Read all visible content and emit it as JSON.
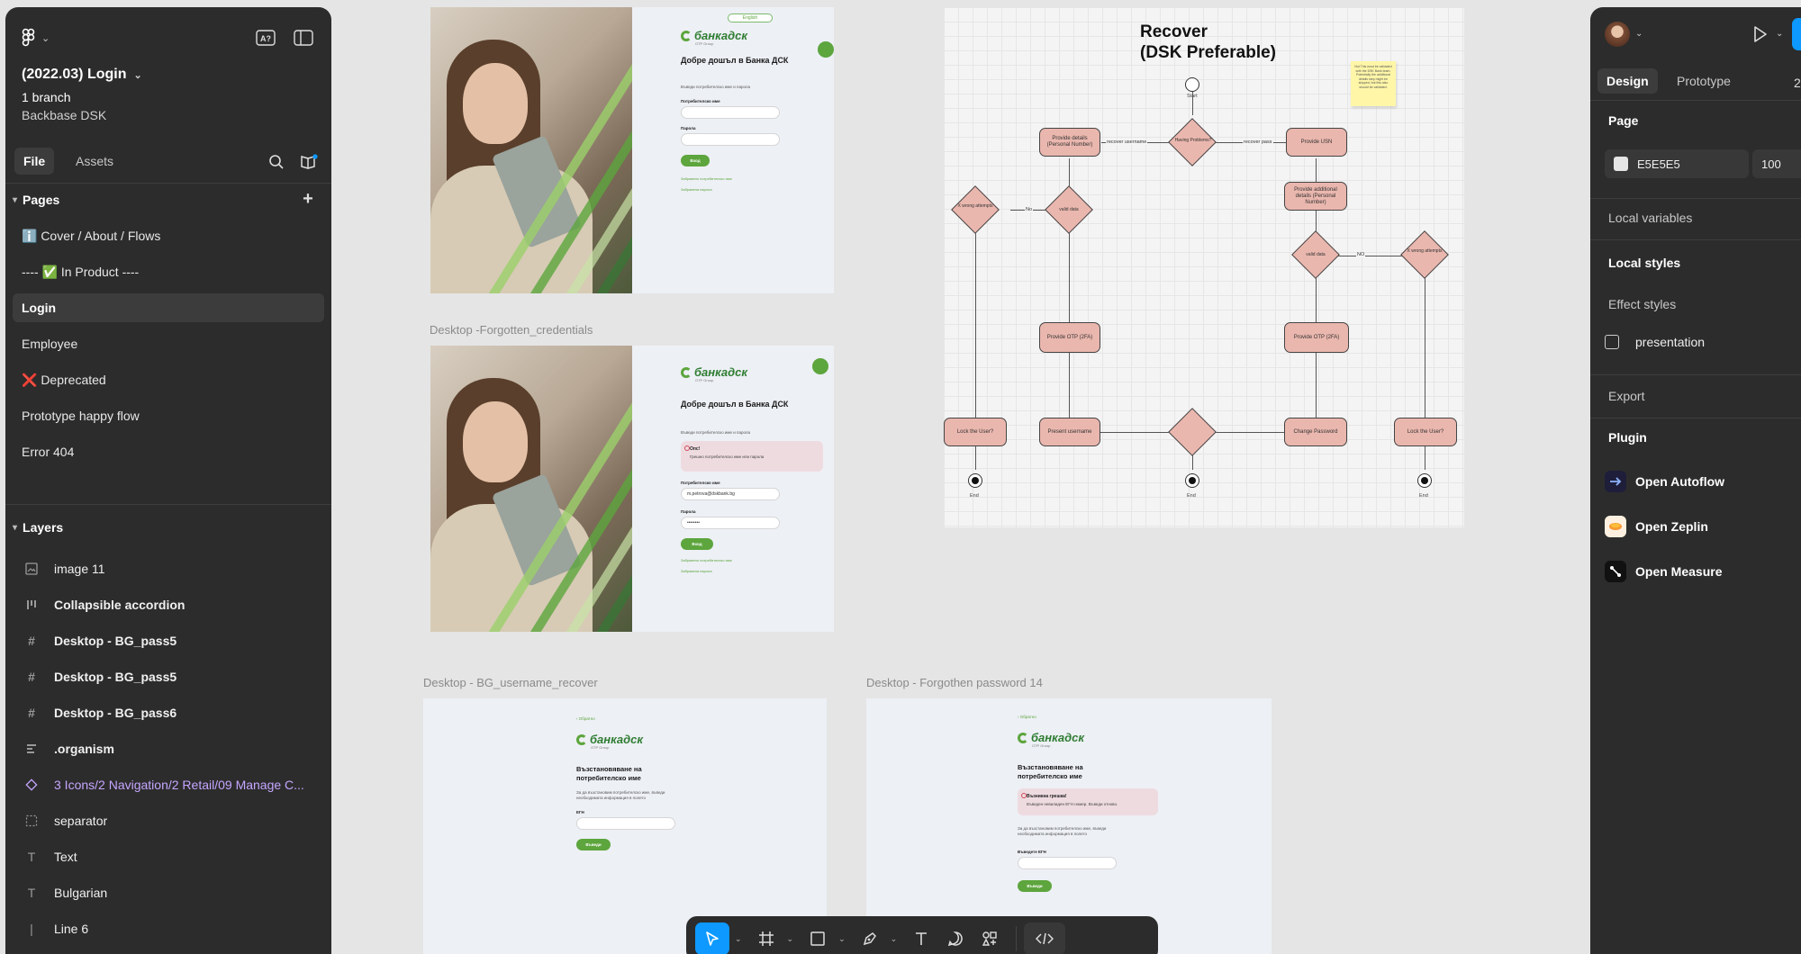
{
  "file": {
    "title": "(2022.03) Login",
    "branch": "1 branch",
    "team": "Backbase DSK"
  },
  "left_tabs": [
    "File",
    "Assets"
  ],
  "pages": {
    "header": "Pages",
    "items": [
      {
        "label": "ℹ️ Cover / About / Flows",
        "active": false
      },
      {
        "label": "---- ✅ In Product ----",
        "active": false
      },
      {
        "label": "Login",
        "active": true
      },
      {
        "label": "Employee",
        "active": false
      },
      {
        "label": "❌ Deprecated",
        "active": false
      },
      {
        "label": "Prototype happy flow",
        "active": false
      },
      {
        "label": "Error 404",
        "active": false
      }
    ]
  },
  "layers": {
    "header": "Layers",
    "items": [
      {
        "label": "image 11",
        "icon": "image-icon",
        "bold": false,
        "purple": false
      },
      {
        "label": "Collapsible accordion",
        "icon": "auto-layout-icon",
        "bold": true,
        "purple": false
      },
      {
        "label": "Desktop - BG_pass5",
        "icon": "frame-icon",
        "bold": true,
        "purple": false
      },
      {
        "label": "Desktop - BG_pass5",
        "icon": "frame-icon",
        "bold": true,
        "purple": false
      },
      {
        "label": "Desktop - BG_pass6",
        "icon": "frame-icon",
        "bold": true,
        "purple": false
      },
      {
        "label": ".organism",
        "icon": "auto-layout-rows-icon",
        "bold": true,
        "purple": false
      },
      {
        "label": "3 Icons/2 Navigation/2 Retail/09 Manage C...",
        "icon": "instance-icon",
        "bold": false,
        "purple": true
      },
      {
        "label": "separator",
        "icon": "dashed-frame-icon",
        "bold": false,
        "purple": false
      },
      {
        "label": "Text",
        "icon": "text-icon",
        "bold": false,
        "purple": false
      },
      {
        "label": "Bulgarian",
        "icon": "text-icon",
        "bold": false,
        "purple": false
      },
      {
        "label": "Line 6",
        "icon": "line-icon",
        "bold": false,
        "purple": false
      }
    ]
  },
  "canvas": {
    "frame_labels": {
      "forgotten": "Desktop -Forgotten_credentials",
      "username_recover": "Desktop - BG_username_recover",
      "forgotten_pw": "Desktop - Forgothen password 14"
    },
    "login_frame": {
      "lang": "English",
      "logo": "банкадск",
      "logo_sub": "OTP Group",
      "title": "Добре дошъл в Банка ДСК",
      "subtitle": "Въведи потребителско име и парола",
      "username_label": "Потребителско име",
      "password_label": "Парола",
      "login_btn": "Вход",
      "link1": "Забравено потребителско име",
      "link2": "Забравена парола"
    },
    "error_frame": {
      "alert_title": "Опс!",
      "alert_body": "Грешно потребителско име или парола",
      "username_value": "m.petrova@dskbank.bg",
      "password_value": "••••••••"
    },
    "recover_frame": {
      "back": "Обратно",
      "title": "Възстановяване на потребителско име",
      "desc": "За да възстановим потребителско име, въведи необходимата информация в полето",
      "egn_label": "ЕГН",
      "btn": "Въведи",
      "alert_title": "Възникна грешка!",
      "alert_body": "Въведен невалиден ЕГН номер. Въведи отново.",
      "egn_label2": "Въведете ЕГН"
    },
    "flow": {
      "title_line1": "Recover",
      "title_line2": "(DSK Preferable)",
      "sticky": "Not This must be validated with the DSK Bank team. Potentially the additional details step might be skipped, but this also should be validated.",
      "start": "Start",
      "end": "End",
      "having_problems": "Having Problems?",
      "recover_username": "recover username",
      "recover_pass": "recover pass",
      "provide_details": "Provide details (Personal Number)",
      "provide_usn": "Provide USN",
      "valid_data": "valid data",
      "x_wrong": "X wrong attempts",
      "no": "No",
      "no_caps": "NO",
      "provide_additional": "Provide additional details (Personal Number)",
      "provide_otp": "Provide OTP (2FA)",
      "lock_user": "Lock the User?",
      "present_username": "Present username",
      "change_password": "Change Password"
    }
  },
  "toolbar": {
    "tools": [
      "move-tool",
      "frame-tool",
      "shape-tool",
      "pen-tool",
      "text-tool",
      "comment-tool",
      "actions-tool",
      "dev-mode-toggle"
    ]
  },
  "right_panel": {
    "tabs": [
      "Design",
      "Prototype"
    ],
    "zoom": "2",
    "page_header": "Page",
    "bg_hex": "E5E5E5",
    "bg_opacity": "100",
    "local_variables": "Local variables",
    "local_styles": "Local styles",
    "effect_styles": "Effect styles",
    "effect_item": "presentation",
    "export": "Export",
    "plugin_header": "Plugin",
    "plugins": [
      "Open Autoflow",
      "Open Zeplin",
      "Open Measure"
    ]
  },
  "colors": {
    "panel_bg": "#2c2c2c",
    "canvas_bg": "#e5e5e5",
    "accent": "#0d99ff",
    "dsk_green": "#5da53d",
    "flow_node": "#eab7ae"
  }
}
